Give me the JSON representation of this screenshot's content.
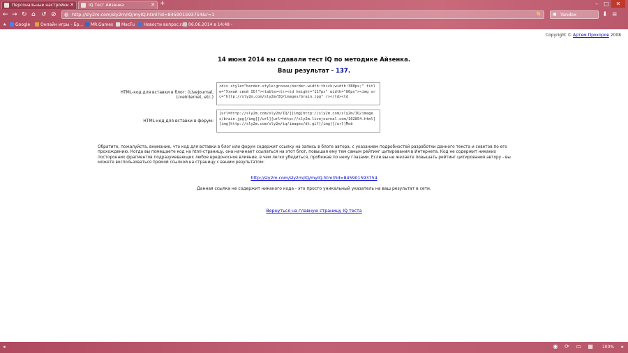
{
  "browser": {
    "tabs": [
      {
        "label": "Персональные настройки",
        "active": false
      },
      {
        "label": "IQ Тест Айзенка",
        "active": true
      }
    ],
    "newtab_glyph": "+",
    "url": "http://sly2m.com/sly2m/IQ/myIQ.html?id=845901593754&r=1",
    "search_placeholder": "Yandex",
    "bookmarks": [
      {
        "label": "Google",
        "color": "#4285f4"
      },
      {
        "label": "Онлайн игры - Бр...",
        "color": "#e8a23c"
      },
      {
        "label": "MR.Games",
        "color": "#2d6cc0"
      },
      {
        "label": "MacFu",
        "color": "#dddddd"
      },
      {
        "label": "Новости вопрос.ru",
        "color": "#3a7bd5"
      },
      {
        "label": "06.06.2014 в 14:48 -",
        "color": "#cccccc"
      }
    ],
    "zoom": "100%"
  },
  "page": {
    "copyright_prefix": "Copyright ©",
    "copyright_author": "Артем Прохоров",
    "copyright_year": "2008",
    "headline": "14 июня 2014 вы сдавали тест IQ по методике Айзенка.",
    "result_prefix": "Ваш результат - ",
    "result_value": "137.",
    "blog_label": "HTML-код для вставки в блог: (LiveJournal, LiveInternet, etc.)",
    "blog_code": "<div style=\"border-style:groove;border-width:thick;width:380px;\" title=\"Узнай свой IQ!\"><table><tr><td height=\"117px\" width=\"80px\"><img src=\"http://sly2m.com/sly2m/IQ/images/brain.jpg\" /></td><td",
    "forum_label": "HTML-код для вставки в форум:",
    "forum_code": "[url=http://sly2m.com/sly2m/IQ/][img]http://sly2m.com/sly2m/IQ/images/brain.jpg[/img][/url][url=http://sly2m.livejournal.com/102854.html][img]http://sly2m.com/sly2m/iq/images/dt.gif[/img][/url]Мой",
    "note": "Обратите, пожалуйста, внимание, что код для вставки в блог или форум содержит ссылку на запись в блоге автора, с указанием подробностей разработки данного текста и советов по его прохождению. Когда вы помещаете код на html-страницу, она начинает ссылаться на этот блог, повышая ему тем самым рейтинг цитирования в Интернета. Код не содержит никаких посторонних фрагментов подразумевающих любое вредоносное влияние, в чем легко убедиться, пробежав по нему глазами. Если вы не желаете повышать рейтинг цитирования автору - вы можете воспользоваться прямой ссылкой на страницу с вашим результатом:",
    "direct_link": "http://sly2m.com/sly2m/IQ/myIQ.html?id=845901593754",
    "direct_link_note": "Данная ссылка не содержит никакого кода - это просто уникальный указатель на ваш результат в сети.",
    "back_link": "Вернуться на главную страницу IQ теста"
  }
}
